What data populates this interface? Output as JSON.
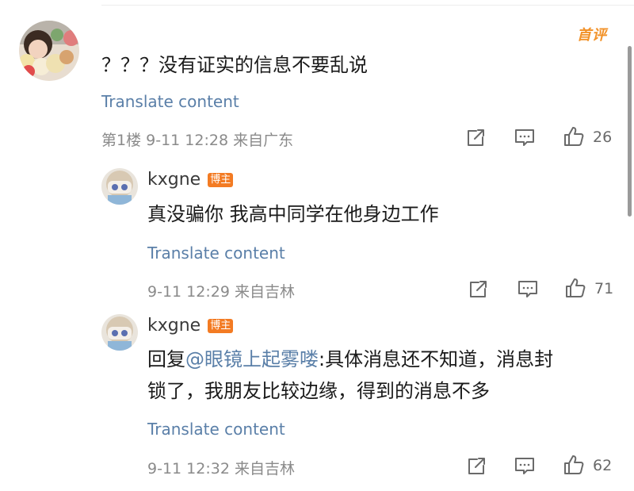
{
  "comment": {
    "first_badge": "首评",
    "text": "？？？没有证实的信息不要乱说",
    "translate": "Translate content",
    "floor": "第1楼",
    "time": "9-11 12:28",
    "location": "来自广东",
    "likes": "26"
  },
  "replies": [
    {
      "username": "kxgne",
      "badge": "博主",
      "text": "真没骗你 我高中同学在他身边工作",
      "translate": "Translate content",
      "time": "9-11 12:29",
      "location": "来自吉林",
      "likes": "71"
    },
    {
      "username": "kxgne",
      "badge": "博主",
      "reply_prefix": "回复",
      "mention": "@眼镜上起雾喽",
      "text_line1": ":具体消息还不知道，消息封",
      "text_line2": "锁了，我朋友比较边缘，得到的消息不多",
      "translate": "Translate content",
      "time": "9-11 12:32",
      "location": "来自吉林",
      "likes": "62"
    }
  ],
  "icons": {
    "share": "share-icon",
    "comment": "comment-icon",
    "like": "thumbs-up-icon"
  },
  "colors": {
    "link": "#5a7fa8",
    "badge": "#f37b23",
    "first_badge": "#f29229"
  }
}
